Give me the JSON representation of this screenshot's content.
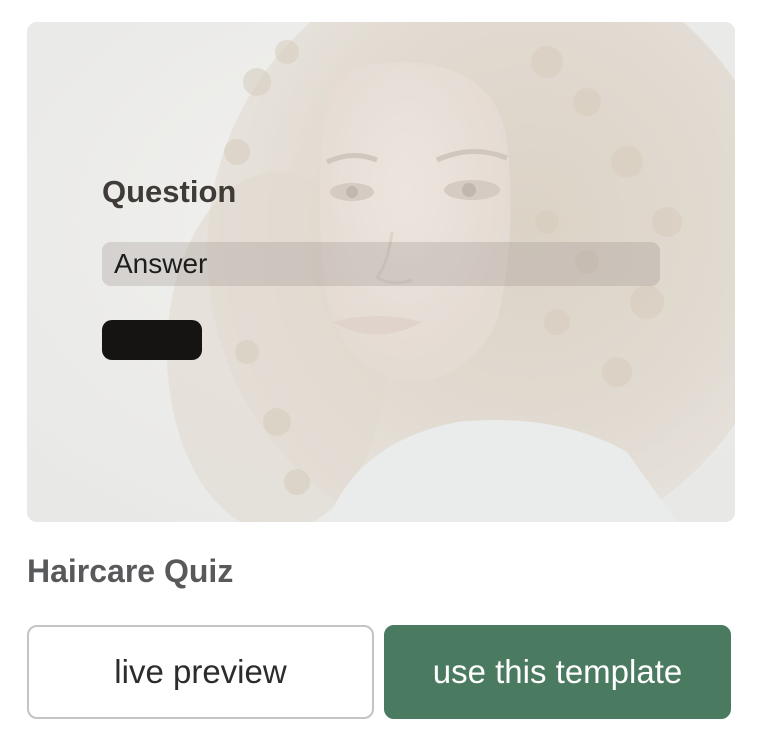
{
  "card": {
    "question": "Question",
    "answer": "Answer",
    "submit_label": ""
  },
  "template": {
    "title": "Haircare Quiz"
  },
  "actions": {
    "live_preview": "live preview",
    "use_template": "use this template"
  },
  "colors": {
    "accent": "#4a7a5f",
    "submit_button": "#161412",
    "title_text": "#58595b"
  }
}
